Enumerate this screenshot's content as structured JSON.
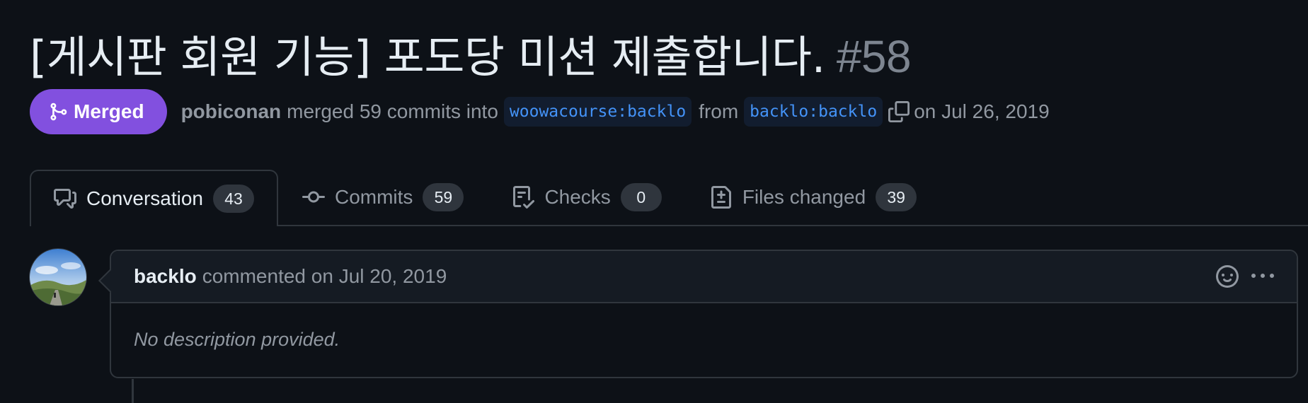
{
  "pr": {
    "title": "[게시판 회원 기능] 포도당 미션 제출합니다.",
    "number": "#58",
    "state": "Merged",
    "author": "pobiconan",
    "merged_text": "merged 59 commits into",
    "base_branch": "woowacourse:backlo",
    "from_text": "from",
    "head_branch": "backlo:backlo",
    "date_text": "on Jul 26, 2019"
  },
  "tabs": [
    {
      "label": "Conversation",
      "count": "43",
      "icon": "comment-discussion-icon"
    },
    {
      "label": "Commits",
      "count": "59",
      "icon": "git-commit-icon"
    },
    {
      "label": "Checks",
      "count": "0",
      "icon": "checklist-icon"
    },
    {
      "label": "Files changed",
      "count": "39",
      "icon": "file-diff-icon"
    }
  ],
  "comment": {
    "author": "backlo",
    "meta": "commented on Jul 20, 2019",
    "body": "No description provided."
  },
  "colors": {
    "background": "#0d1117",
    "merged": "#8250df",
    "link": "#4493f8",
    "border": "#30363d",
    "muted": "#9198a1"
  }
}
